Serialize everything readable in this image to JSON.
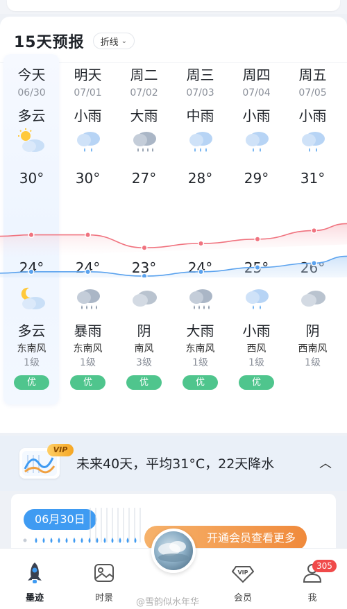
{
  "forecast": {
    "title": "15天预报",
    "mode_label": "折线",
    "days": [
      {
        "name": "今天",
        "date": "06/30",
        "cond_day": "多云",
        "icon_day": "partly-cloudy-sun-icon",
        "high": "30°",
        "low": "24°",
        "icon_night": "partly-cloudy-moon-icon",
        "cond_night": "多云",
        "wind_dir": "东南风",
        "wind_level": "1级",
        "aqi": "优"
      },
      {
        "name": "明天",
        "date": "07/01",
        "cond_day": "小雨",
        "icon_day": "light-rain-icon",
        "high": "30°",
        "low": "24°",
        "icon_night": "heavy-rain-icon",
        "cond_night": "暴雨",
        "wind_dir": "东南风",
        "wind_level": "1级",
        "aqi": "优"
      },
      {
        "name": "周二",
        "date": "07/02",
        "cond_day": "大雨",
        "icon_day": "heavy-rain-icon",
        "high": "27°",
        "low": "23°",
        "icon_night": "overcast-icon",
        "cond_night": "阴",
        "wind_dir": "南风",
        "wind_level": "3级",
        "aqi": "优"
      },
      {
        "name": "周三",
        "date": "07/03",
        "cond_day": "中雨",
        "icon_day": "moderate-rain-icon",
        "high": "28°",
        "low": "24°",
        "icon_night": "heavy-rain-icon",
        "cond_night": "大雨",
        "wind_dir": "东南风",
        "wind_level": "1级",
        "aqi": "优"
      },
      {
        "name": "周四",
        "date": "07/04",
        "cond_day": "小雨",
        "icon_day": "light-rain-icon",
        "high": "29°",
        "low": "25°",
        "icon_night": "light-rain-icon",
        "cond_night": "小雨",
        "wind_dir": "西风",
        "wind_level": "1级",
        "aqi": "优"
      },
      {
        "name": "周五",
        "date": "07/05",
        "cond_day": "小雨",
        "icon_day": "light-rain-icon",
        "high": "31°",
        "low": "26°",
        "icon_night": "overcast-icon",
        "cond_night": "阴",
        "wind_dir": "西南风",
        "wind_level": "1级",
        "aqi": ""
      }
    ]
  },
  "chart_data": {
    "type": "line",
    "categories": [
      "今天",
      "明天",
      "周二",
      "周三",
      "周四",
      "周五"
    ],
    "series": [
      {
        "name": "",
        "values": [
          30,
          30,
          27,
          28,
          29,
          31
        ]
      },
      {
        "name": "",
        "values": [
          24,
          24,
          23,
          24,
          25,
          26
        ]
      }
    ]
  },
  "colors": {
    "high_line": "#f0737f",
    "low_line": "#5aa2ee",
    "aqi_good": "#4fc58d",
    "accent": "#3f9bf2"
  },
  "summary": {
    "vip_tag": "VIP",
    "text": "未来40天，平均31°C，22天降水"
  },
  "detail": {
    "date_pill": "06月30日",
    "open_vip": "开通会员查看更多"
  },
  "tabbar": {
    "tabs": [
      {
        "label": "墨迹",
        "icon": "rocket-icon"
      },
      {
        "label": "时景",
        "icon": "photo-icon"
      },
      {
        "label": "会员",
        "icon": "vip-icon"
      },
      {
        "label": "我",
        "icon": "user-icon"
      }
    ],
    "badge": "305"
  },
  "watermark": "@雪韵似水年华"
}
